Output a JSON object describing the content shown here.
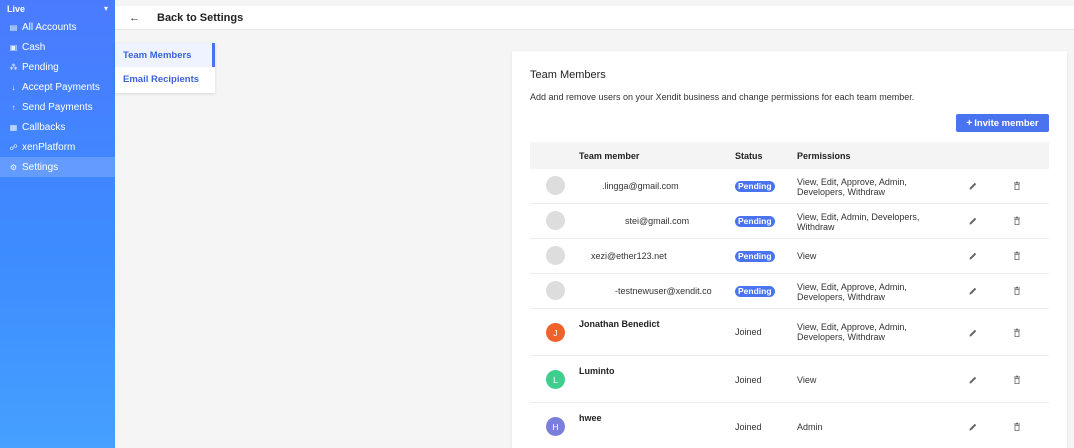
{
  "sidebar": {
    "environment": "Live",
    "items": [
      {
        "label": "All Accounts",
        "icon": "list-icon"
      },
      {
        "label": "Cash",
        "icon": "cash-icon"
      },
      {
        "label": "Pending",
        "icon": "pending-icon"
      },
      {
        "label": "Accept Payments",
        "icon": "arrow-down-icon"
      },
      {
        "label": "Send Payments",
        "icon": "arrow-up-icon"
      },
      {
        "label": "Callbacks",
        "icon": "callbacks-icon"
      },
      {
        "label": "xenPlatform",
        "icon": "users-icon"
      },
      {
        "label": "Settings",
        "icon": "gear-icon",
        "active": true
      }
    ]
  },
  "topbar": {
    "back_label": "Back to Settings"
  },
  "subnav": {
    "items": [
      {
        "label": "Team Members",
        "active": true
      },
      {
        "label": "Email Recipients"
      }
    ]
  },
  "card": {
    "title": "Team Members",
    "description": "Add and remove users on your Xendit business and change permissions for each team member.",
    "invite_label": "Invite member",
    "columns": {
      "member": "Team member",
      "status": "Status",
      "permissions": "Permissions"
    },
    "rows": [
      {
        "email": ".lingga@gmail.com",
        "status": "Pending",
        "permissions": [
          "View, Edit, Approve, Admin,",
          "Developers, Withdraw"
        ]
      },
      {
        "email": "stei@gmail.com",
        "status": "Pending",
        "permissions": [
          "View, Edit, Admin, Developers,",
          "Withdraw"
        ]
      },
      {
        "email": "xezi@ether123.net",
        "status": "Pending",
        "permissions": [
          "View"
        ]
      },
      {
        "email": "-testnewuser@xendit.co",
        "status": "Pending",
        "permissions": [
          "View, Edit, Approve, Admin,",
          "Developers, Withdraw"
        ]
      },
      {
        "name": "Jonathan Benedict",
        "initial": "J",
        "avatar_color": "#f0612b",
        "status": "Joined",
        "permissions": [
          "View, Edit, Approve, Admin,",
          "Developers, Withdraw"
        ]
      },
      {
        "name": "Luminto",
        "initial": "L",
        "avatar_color": "#3ecf8e",
        "status": "Joined",
        "permissions": [
          "View"
        ]
      },
      {
        "name": "hwee",
        "initial": "H",
        "avatar_color": "#7b7fdc",
        "status": "Joined",
        "permissions": [
          "Admin"
        ]
      }
    ]
  },
  "colors": {
    "accent": "#4a73f0",
    "sidebar_top": "#4a7bff",
    "sidebar_bottom": "#45a0ff"
  }
}
